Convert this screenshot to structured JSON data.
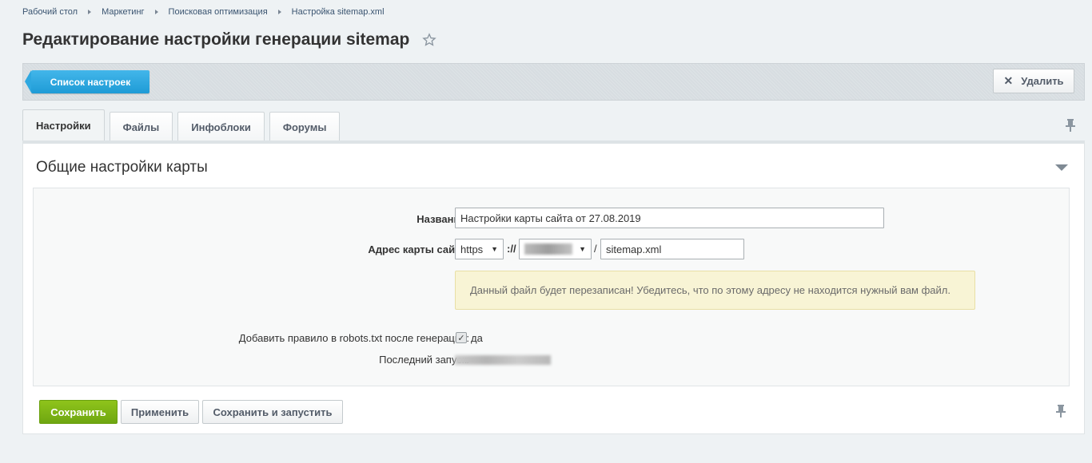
{
  "breadcrumb": [
    "Рабочий стол",
    "Маркетинг",
    "Поисковая оптимизация",
    "Настройка sitemap.xml"
  ],
  "title": "Редактирование настройки генерации sitemap",
  "toolbar": {
    "list_label": "Список настроек",
    "delete_label": "Удалить"
  },
  "tabs": [
    "Настройки",
    "Файлы",
    "Инфоблоки",
    "Форумы"
  ],
  "section": {
    "title": "Общие настройки карты"
  },
  "form": {
    "name_label": "Название:",
    "name_value": "Настройки карты сайта от 27.08.2019",
    "address_label": "Адрес карты сайта:",
    "protocol": "https",
    "separator": "://",
    "slash": "/",
    "filename": "sitemap.xml",
    "warning": "Данный файл будет перезаписан! Убедитесь, что по этому адресу не находится нужный вам файл.",
    "robots_label": "Добавить правило в robots.txt после генерации:",
    "robots_value": "да",
    "last_run_label": "Последний запуск:"
  },
  "buttons": {
    "save": "Сохранить",
    "apply": "Применить",
    "save_run": "Сохранить и запустить"
  },
  "colors": {
    "accent": "#2ea8e0",
    "save": "#7fb519",
    "warning_bg": "#f8f4d5"
  }
}
